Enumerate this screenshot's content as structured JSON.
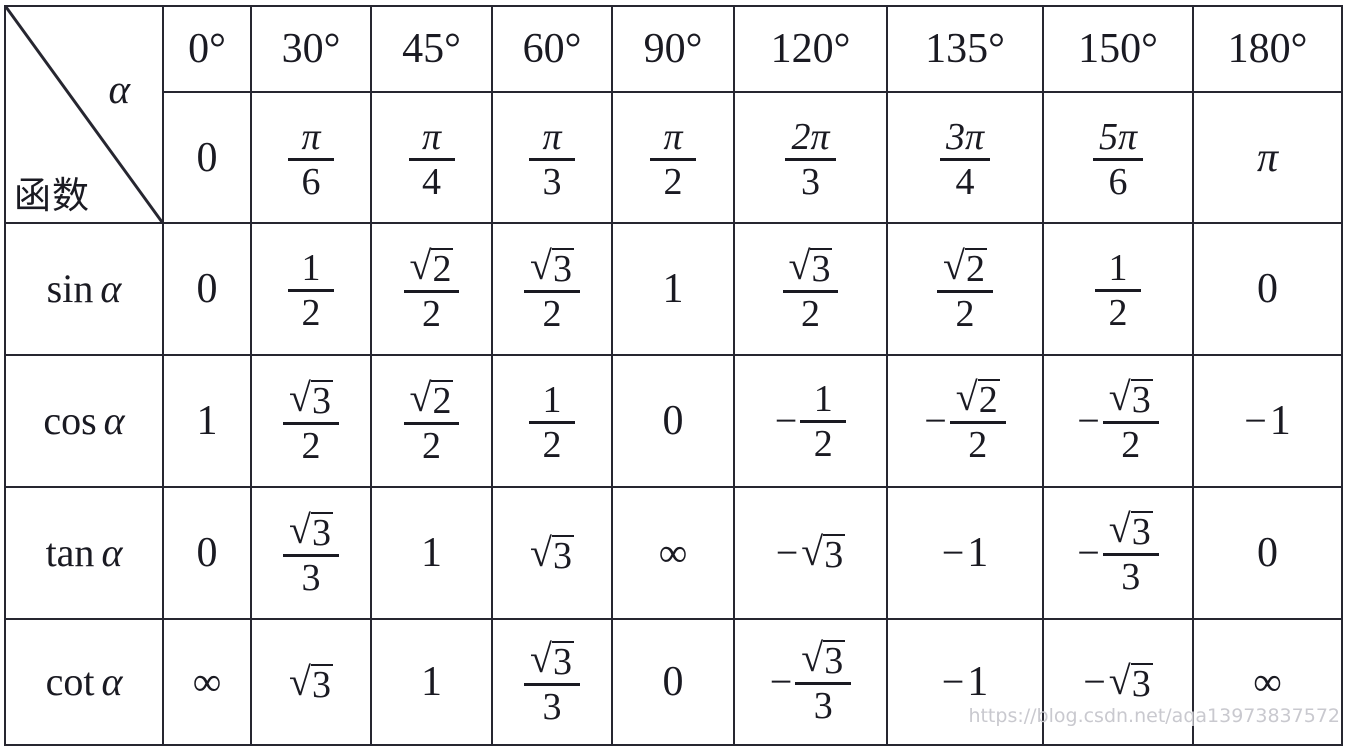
{
  "corner": {
    "angle_label": "α",
    "function_label": "函数",
    "diagonal": "diagonal-divider"
  },
  "columns": {
    "degrees": [
      "0°",
      "30°",
      "45°",
      "60°",
      "90°",
      "120°",
      "135°",
      "150°",
      "180°"
    ],
    "radians": [
      {
        "type": "plain",
        "text": "0"
      },
      {
        "type": "fraction",
        "num": "π",
        "den": "6"
      },
      {
        "type": "fraction",
        "num": "π",
        "den": "4"
      },
      {
        "type": "fraction",
        "num": "π",
        "den": "3"
      },
      {
        "type": "fraction",
        "num": "π",
        "den": "2"
      },
      {
        "type": "fraction",
        "num": "2π",
        "den": "3"
      },
      {
        "type": "fraction",
        "num": "3π",
        "den": "4"
      },
      {
        "type": "fraction",
        "num": "5π",
        "den": "6"
      },
      {
        "type": "plain",
        "text": "π",
        "italic": true
      }
    ]
  },
  "rows": [
    {
      "function": "sin",
      "label": "sin α",
      "values": [
        {
          "type": "plain",
          "text": "0"
        },
        {
          "type": "fraction",
          "num": "1",
          "den": "2"
        },
        {
          "type": "fraction",
          "num": "√2",
          "radical": "2",
          "den": "2"
        },
        {
          "type": "fraction",
          "num": "√3",
          "radical": "3",
          "den": "2"
        },
        {
          "type": "plain",
          "text": "1"
        },
        {
          "type": "fraction",
          "num": "√3",
          "radical": "3",
          "den": "2"
        },
        {
          "type": "fraction",
          "num": "√2",
          "radical": "2",
          "den": "2"
        },
        {
          "type": "fraction",
          "num": "1",
          "den": "2"
        },
        {
          "type": "plain",
          "text": "0"
        }
      ]
    },
    {
      "function": "cos",
      "label": "cos α",
      "values": [
        {
          "type": "plain",
          "text": "1"
        },
        {
          "type": "fraction",
          "num": "√3",
          "radical": "3",
          "den": "2"
        },
        {
          "type": "fraction",
          "num": "√2",
          "radical": "2",
          "den": "2"
        },
        {
          "type": "fraction",
          "num": "1",
          "den": "2"
        },
        {
          "type": "plain",
          "text": "0"
        },
        {
          "type": "fraction",
          "sign": "−",
          "num": "1",
          "den": "2"
        },
        {
          "type": "fraction",
          "sign": "−",
          "num": "√2",
          "radical": "2",
          "den": "2"
        },
        {
          "type": "fraction",
          "sign": "−",
          "num": "√3",
          "radical": "3",
          "den": "2"
        },
        {
          "type": "plain",
          "sign": "−",
          "text": "1"
        }
      ]
    },
    {
      "function": "tan",
      "label": "tan α",
      "values": [
        {
          "type": "plain",
          "text": "0"
        },
        {
          "type": "fraction",
          "num": "√3",
          "radical": "3",
          "den": "3"
        },
        {
          "type": "plain",
          "text": "1"
        },
        {
          "type": "radical",
          "radical": "3"
        },
        {
          "type": "infinity",
          "text": "∞"
        },
        {
          "type": "radical",
          "sign": "−",
          "radical": "3"
        },
        {
          "type": "plain",
          "sign": "−",
          "text": "1"
        },
        {
          "type": "fraction",
          "sign": "−",
          "num": "√3",
          "radical": "3",
          "den": "3"
        },
        {
          "type": "plain",
          "text": "0"
        }
      ]
    },
    {
      "function": "cot",
      "label": "cot α",
      "values": [
        {
          "type": "infinity",
          "text": "∞"
        },
        {
          "type": "radical",
          "radical": "3"
        },
        {
          "type": "plain",
          "text": "1"
        },
        {
          "type": "fraction",
          "num": "√3",
          "radical": "3",
          "den": "3"
        },
        {
          "type": "plain",
          "text": "0"
        },
        {
          "type": "fraction",
          "sign": "−",
          "num": "√3",
          "radical": "3",
          "den": "3"
        },
        {
          "type": "plain",
          "sign": "−",
          "text": "1"
        },
        {
          "type": "radical",
          "sign": "−",
          "radical": "3"
        },
        {
          "type": "infinity",
          "text": "∞"
        }
      ]
    }
  ],
  "watermark": {
    "text": "https://blog.csdn.net/aqa13973837572"
  },
  "colors": {
    "border": "#262630",
    "text": "#1a1a22",
    "background": "#ffffff",
    "watermark": "#c9c9cf"
  }
}
